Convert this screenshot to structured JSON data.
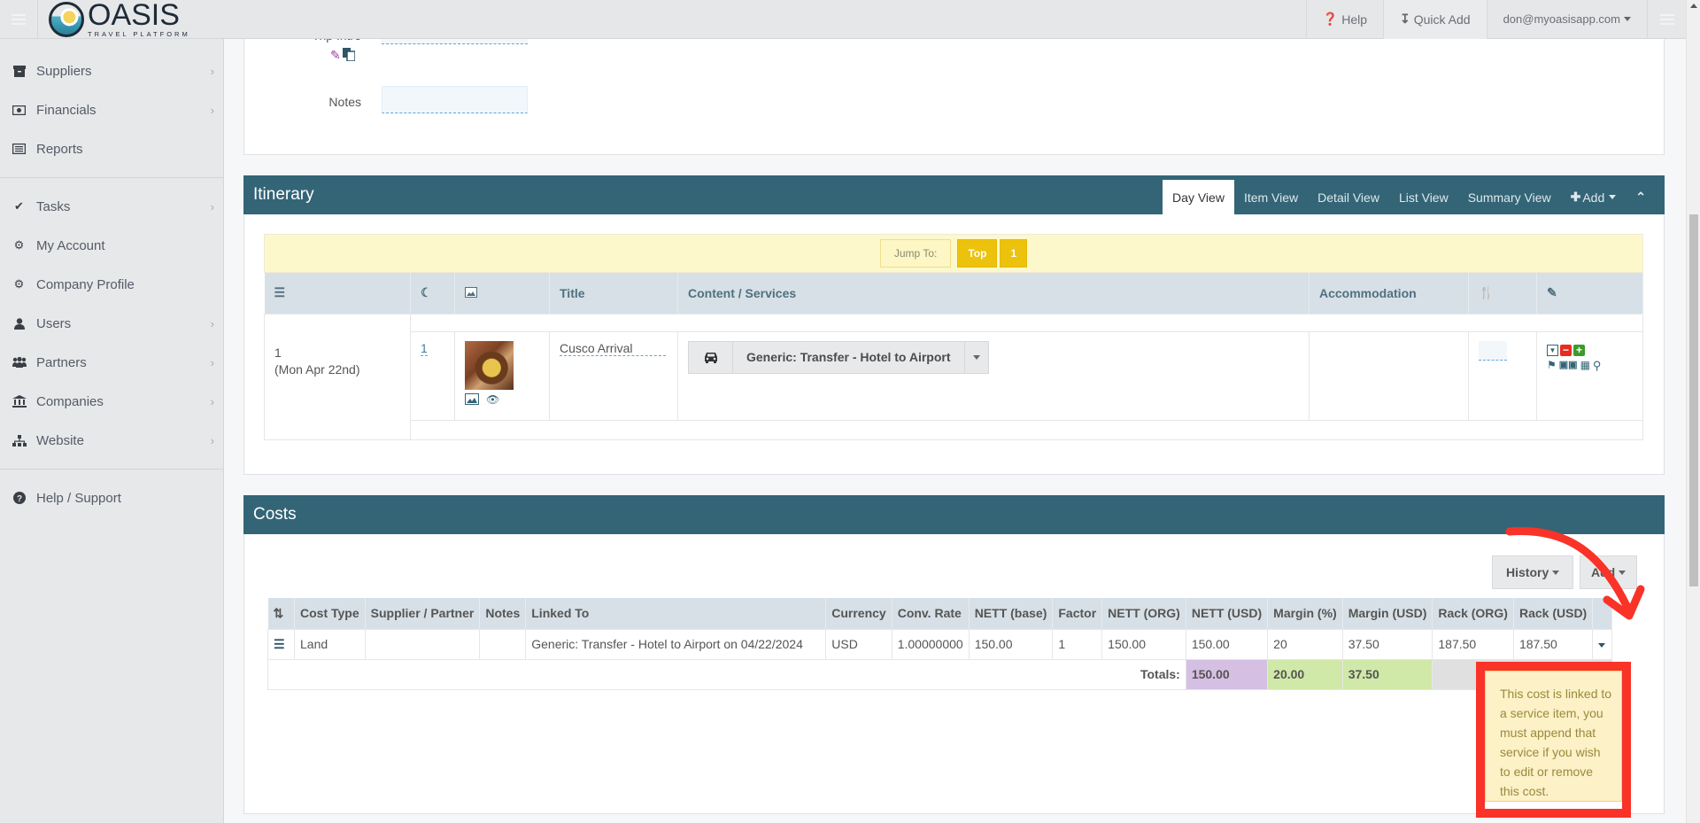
{
  "topbar": {
    "logo_name": "OASIS",
    "logo_subtitle": "TRAVEL PLATFORM",
    "help_label": "Help",
    "quick_add_label": "Quick Add",
    "user_email": "don@myoasisapp.com"
  },
  "sidebar": {
    "items": [
      {
        "label": "Suppliers",
        "icon": "archive-icon",
        "has_submenu": true
      },
      {
        "label": "Financials",
        "icon": "money-icon",
        "has_submenu": true
      },
      {
        "label": "Reports",
        "icon": "list-alt-icon",
        "has_submenu": false
      },
      {
        "label": "Tasks",
        "icon": "check-icon",
        "has_submenu": true
      },
      {
        "label": "My Account",
        "icon": "gear-icon",
        "has_submenu": false
      },
      {
        "label": "Company Profile",
        "icon": "gears-icon",
        "has_submenu": false
      },
      {
        "label": "Users",
        "icon": "user-icon",
        "has_submenu": true
      },
      {
        "label": "Partners",
        "icon": "users-icon",
        "has_submenu": true
      },
      {
        "label": "Companies",
        "icon": "bank-icon",
        "has_submenu": true
      },
      {
        "label": "Website",
        "icon": "sitemap-icon",
        "has_submenu": true
      },
      {
        "label": "Help / Support",
        "icon": "question-circle-icon",
        "has_submenu": false
      }
    ]
  },
  "trip": {
    "intro_label": "Trip Intro",
    "notes_label": "Notes",
    "notes_value": ""
  },
  "itinerary": {
    "title": "Itinerary",
    "tabs": [
      "Day View",
      "Item View",
      "Detail View",
      "List View",
      "Summary View"
    ],
    "active_tab": "Day View",
    "add_label": "Add",
    "jump_label": "Jump To:",
    "jump_buttons": [
      "Top",
      "1"
    ],
    "columns": {
      "title": "Title",
      "content": "Content / Services",
      "accommodation": "Accommodation"
    },
    "days": [
      {
        "day_number": "1",
        "day_date": "(Mon Apr 22nd)",
        "nights": "1",
        "title": "Cusco Arrival",
        "service": "Generic: Transfer - Hotel to Airport",
        "accommodation": ""
      }
    ]
  },
  "costs": {
    "title": "Costs",
    "history_label": "History",
    "add_label": "Add",
    "columns": [
      "Cost Type",
      "Supplier / Partner",
      "Notes",
      "Linked To",
      "Currency",
      "Conv. Rate",
      "NETT (base)",
      "Factor",
      "NETT (ORG)",
      "NETT (USD)",
      "Margin (%)",
      "Margin (USD)",
      "Rack (ORG)",
      "Rack (USD)"
    ],
    "rows": [
      [
        "Land",
        "",
        "",
        "Generic: Transfer - Hotel to Airport on 04/22/2024",
        "USD",
        "1.00000000",
        "150.00",
        "1",
        "150.00",
        "150.00",
        "20",
        "37.50",
        "187.50",
        "187.50"
      ]
    ],
    "totals_label": "Totals:",
    "totals": {
      "nett_usd": "150.00",
      "margin_pct": "20.00",
      "margin_usd": "37.50"
    },
    "tooltip": "This cost is linked to a service item, you must append that service if you wish to edit or remove this cost."
  },
  "colors": {
    "section_header": "#336577",
    "jump_button": "#edc20c",
    "totals_purple": "#d5bfe2",
    "totals_green": "#d0e8a8",
    "annotation_red": "#f93328"
  }
}
